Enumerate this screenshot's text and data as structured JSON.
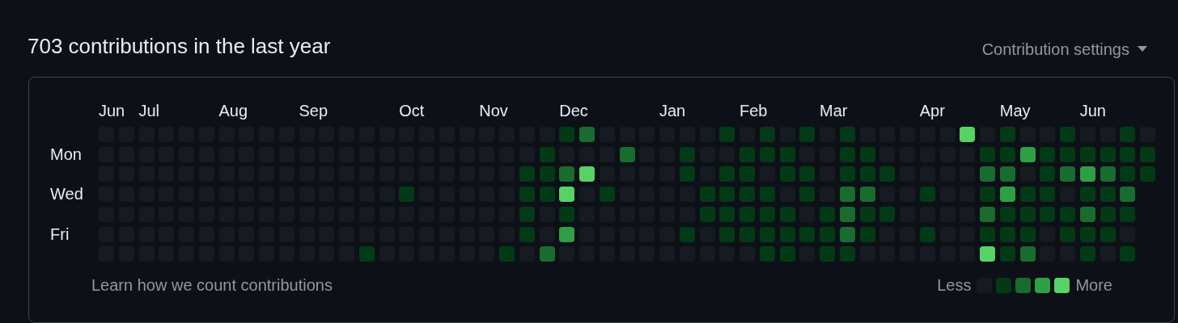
{
  "title": "703 contributions in the last year",
  "settings": {
    "label": "Contribution settings"
  },
  "day_labels": [
    "Mon",
    "Wed",
    "Fri"
  ],
  "weeks": [
    {
      "month": "Jun",
      "days": [
        {
          "color": "#161b22"
        },
        {
          "color": "#161b22"
        },
        {
          "color": "#161b22"
        },
        {
          "color": "#161b22"
        },
        {
          "color": "#161b22"
        },
        {
          "color": "#161b22"
        },
        {
          "color": "#161b22"
        }
      ]
    },
    {
      "days": [
        {
          "color": "#161b22"
        },
        {
          "color": "#161b22"
        },
        {
          "color": "#161b22"
        },
        {
          "color": "#161b22"
        },
        {
          "color": "#161b22"
        },
        {
          "color": "#161b22"
        },
        {
          "color": "#161b22"
        }
      ]
    },
    {
      "month": "Jul",
      "days": [
        {
          "color": "#161b22"
        },
        {
          "color": "#161b22"
        },
        {
          "color": "#161b22"
        },
        {
          "color": "#161b22"
        },
        {
          "color": "#161b22"
        },
        {
          "color": "#161b22"
        },
        {
          "color": "#161b22"
        }
      ]
    },
    {
      "days": [
        {
          "color": "#161b22"
        },
        {
          "color": "#161b22"
        },
        {
          "color": "#161b22"
        },
        {
          "color": "#161b22"
        },
        {
          "color": "#161b22"
        },
        {
          "color": "#161b22"
        },
        {
          "color": "#161b22"
        }
      ]
    },
    {
      "days": [
        {
          "color": "#161b22"
        },
        {
          "color": "#161b22"
        },
        {
          "color": "#161b22"
        },
        {
          "color": "#161b22"
        },
        {
          "color": "#161b22"
        },
        {
          "color": "#161b22"
        },
        {
          "color": "#161b22"
        }
      ]
    },
    {
      "days": [
        {
          "color": "#161b22"
        },
        {
          "color": "#161b22"
        },
        {
          "color": "#161b22"
        },
        {
          "color": "#161b22"
        },
        {
          "color": "#161b22"
        },
        {
          "color": "#161b22"
        },
        {
          "color": "#161b22"
        }
      ]
    },
    {
      "month": "Aug",
      "days": [
        {
          "color": "#161b22"
        },
        {
          "color": "#161b22"
        },
        {
          "color": "#161b22"
        },
        {
          "color": "#161b22"
        },
        {
          "color": "#161b22"
        },
        {
          "color": "#161b22"
        },
        {
          "color": "#161b22"
        }
      ]
    },
    {
      "days": [
        {
          "color": "#161b22"
        },
        {
          "color": "#161b22"
        },
        {
          "color": "#161b22"
        },
        {
          "color": "#161b22"
        },
        {
          "color": "#161b22"
        },
        {
          "color": "#161b22"
        },
        {
          "color": "#161b22"
        }
      ]
    },
    {
      "days": [
        {
          "color": "#161b22"
        },
        {
          "color": "#161b22"
        },
        {
          "color": "#161b22"
        },
        {
          "color": "#161b22"
        },
        {
          "color": "#161b22"
        },
        {
          "color": "#161b22"
        },
        {
          "color": "#161b22"
        }
      ]
    },
    {
      "days": [
        {
          "color": "#161b22"
        },
        {
          "color": "#161b22"
        },
        {
          "color": "#161b22"
        },
        {
          "color": "#161b22"
        },
        {
          "color": "#161b22"
        },
        {
          "color": "#161b22"
        },
        {
          "color": "#161b22"
        }
      ]
    },
    {
      "month": "Sep",
      "days": [
        {
          "color": "#161b22"
        },
        {
          "color": "#161b22"
        },
        {
          "color": "#161b22"
        },
        {
          "color": "#161b22"
        },
        {
          "color": "#161b22"
        },
        {
          "color": "#161b22"
        },
        {
          "color": "#161b22"
        }
      ]
    },
    {
      "days": [
        {
          "color": "#161b22"
        },
        {
          "color": "#161b22"
        },
        {
          "color": "#161b22"
        },
        {
          "color": "#161b22"
        },
        {
          "color": "#161b22"
        },
        {
          "color": "#161b22"
        },
        {
          "color": "#161b22"
        }
      ]
    },
    {
      "days": [
        {
          "color": "#161b22"
        },
        {
          "color": "#161b22"
        },
        {
          "color": "#161b22"
        },
        {
          "color": "#161b22"
        },
        {
          "color": "#161b22"
        },
        {
          "color": "#161b22"
        },
        {
          "color": "#161b22"
        }
      ]
    },
    {
      "days": [
        {
          "color": "#161b22"
        },
        {
          "color": "#161b22"
        },
        {
          "color": "#161b22"
        },
        {
          "color": "#161b22"
        },
        {
          "color": "#161b22"
        },
        {
          "color": "#161b22"
        },
        {
          "color": "#033a16"
        }
      ]
    },
    {
      "days": [
        {
          "color": "#161b22"
        },
        {
          "color": "#161b22"
        },
        {
          "color": "#161b22"
        },
        {
          "color": "#161b22"
        },
        {
          "color": "#161b22"
        },
        {
          "color": "#161b22"
        },
        {
          "color": "#161b22"
        }
      ]
    },
    {
      "month": "Oct",
      "days": [
        {
          "color": "#161b22"
        },
        {
          "color": "#161b22"
        },
        {
          "color": "#161b22"
        },
        {
          "color": "#033a16"
        },
        {
          "color": "#161b22"
        },
        {
          "color": "#161b22"
        },
        {
          "color": "#161b22"
        }
      ]
    },
    {
      "days": [
        {
          "color": "#161b22"
        },
        {
          "color": "#161b22"
        },
        {
          "color": "#161b22"
        },
        {
          "color": "#161b22"
        },
        {
          "color": "#161b22"
        },
        {
          "color": "#161b22"
        },
        {
          "color": "#161b22"
        }
      ]
    },
    {
      "days": [
        {
          "color": "#161b22"
        },
        {
          "color": "#161b22"
        },
        {
          "color": "#161b22"
        },
        {
          "color": "#161b22"
        },
        {
          "color": "#161b22"
        },
        {
          "color": "#161b22"
        },
        {
          "color": "#161b22"
        }
      ]
    },
    {
      "days": [
        {
          "color": "#161b22"
        },
        {
          "color": "#161b22"
        },
        {
          "color": "#161b22"
        },
        {
          "color": "#161b22"
        },
        {
          "color": "#161b22"
        },
        {
          "color": "#161b22"
        },
        {
          "color": "#161b22"
        }
      ]
    },
    {
      "month": "Nov",
      "days": [
        {
          "color": "#161b22"
        },
        {
          "color": "#161b22"
        },
        {
          "color": "#161b22"
        },
        {
          "color": "#161b22"
        },
        {
          "color": "#161b22"
        },
        {
          "color": "#161b22"
        },
        {
          "color": "#161b22"
        }
      ]
    },
    {
      "days": [
        {
          "color": "#161b22"
        },
        {
          "color": "#161b22"
        },
        {
          "color": "#161b22"
        },
        {
          "color": "#161b22"
        },
        {
          "color": "#161b22"
        },
        {
          "color": "#161b22"
        },
        {
          "color": "#033a16"
        }
      ]
    },
    {
      "days": [
        {
          "color": "#161b22"
        },
        {
          "color": "#161b22"
        },
        {
          "color": "#033a16"
        },
        {
          "color": "#033a16"
        },
        {
          "color": "#033a16"
        },
        {
          "color": "#033a16"
        },
        {
          "color": "#161b22"
        }
      ]
    },
    {
      "days": [
        {
          "color": "#161b22"
        },
        {
          "color": "#033a16"
        },
        {
          "color": "#033a16"
        },
        {
          "color": "#033a16"
        },
        {
          "color": "#161b22"
        },
        {
          "color": "#161b22"
        },
        {
          "color": "#196c2e"
        }
      ]
    },
    {
      "month": "Dec",
      "days": [
        {
          "color": "#033a16"
        },
        {
          "color": "#161b22"
        },
        {
          "color": "#196c2e"
        },
        {
          "color": "#56d364"
        },
        {
          "color": "#033a16"
        },
        {
          "color": "#2ea043"
        },
        {
          "color": "#161b22"
        }
      ]
    },
    {
      "days": [
        {
          "color": "#196c2e"
        },
        {
          "color": "#161b22"
        },
        {
          "color": "#56d364"
        },
        {
          "color": "#161b22"
        },
        {
          "color": "#161b22"
        },
        {
          "color": "#161b22"
        },
        {
          "color": "#161b22"
        }
      ]
    },
    {
      "days": [
        {
          "color": "#161b22"
        },
        {
          "color": "#161b22"
        },
        {
          "color": "#161b22"
        },
        {
          "color": "#033a16"
        },
        {
          "color": "#161b22"
        },
        {
          "color": "#161b22"
        },
        {
          "color": "#161b22"
        }
      ]
    },
    {
      "days": [
        {
          "color": "#161b22"
        },
        {
          "color": "#196c2e"
        },
        {
          "color": "#161b22"
        },
        {
          "color": "#161b22"
        },
        {
          "color": "#161b22"
        },
        {
          "color": "#161b22"
        },
        {
          "color": "#161b22"
        }
      ]
    },
    {
      "days": [
        {
          "color": "#161b22"
        },
        {
          "color": "#161b22"
        },
        {
          "color": "#161b22"
        },
        {
          "color": "#161b22"
        },
        {
          "color": "#161b22"
        },
        {
          "color": "#161b22"
        },
        {
          "color": "#161b22"
        }
      ]
    },
    {
      "month": "Jan",
      "days": [
        {
          "color": "#161b22"
        },
        {
          "color": "#161b22"
        },
        {
          "color": "#161b22"
        },
        {
          "color": "#161b22"
        },
        {
          "color": "#161b22"
        },
        {
          "color": "#161b22"
        },
        {
          "color": "#161b22"
        }
      ]
    },
    {
      "days": [
        {
          "color": "#161b22"
        },
        {
          "color": "#033a16"
        },
        {
          "color": "#033a16"
        },
        {
          "color": "#161b22"
        },
        {
          "color": "#161b22"
        },
        {
          "color": "#033a16"
        },
        {
          "color": "#161b22"
        }
      ]
    },
    {
      "days": [
        {
          "color": "#161b22"
        },
        {
          "color": "#161b22"
        },
        {
          "color": "#161b22"
        },
        {
          "color": "#033a16"
        },
        {
          "color": "#033a16"
        },
        {
          "color": "#161b22"
        },
        {
          "color": "#161b22"
        }
      ]
    },
    {
      "days": [
        {
          "color": "#033a16"
        },
        {
          "color": "#161b22"
        },
        {
          "color": "#033a16"
        },
        {
          "color": "#033a16"
        },
        {
          "color": "#033a16"
        },
        {
          "color": "#033a16"
        },
        {
          "color": "#161b22"
        }
      ]
    },
    {
      "month": "Feb",
      "days": [
        {
          "color": "#161b22"
        },
        {
          "color": "#033a16"
        },
        {
          "color": "#033a16"
        },
        {
          "color": "#033a16"
        },
        {
          "color": "#033a16"
        },
        {
          "color": "#033a16"
        },
        {
          "color": "#161b22"
        }
      ]
    },
    {
      "days": [
        {
          "color": "#033a16"
        },
        {
          "color": "#033a16"
        },
        {
          "color": "#161b22"
        },
        {
          "color": "#033a16"
        },
        {
          "color": "#033a16"
        },
        {
          "color": "#033a16"
        },
        {
          "color": "#033a16"
        }
      ]
    },
    {
      "days": [
        {
          "color": "#161b22"
        },
        {
          "color": "#033a16"
        },
        {
          "color": "#033a16"
        },
        {
          "color": "#161b22"
        },
        {
          "color": "#033a16"
        },
        {
          "color": "#033a16"
        },
        {
          "color": "#033a16"
        }
      ]
    },
    {
      "days": [
        {
          "color": "#033a16"
        },
        {
          "color": "#161b22"
        },
        {
          "color": "#033a16"
        },
        {
          "color": "#033a16"
        },
        {
          "color": "#161b22"
        },
        {
          "color": "#033a16"
        },
        {
          "color": "#161b22"
        }
      ]
    },
    {
      "month": "Mar",
      "days": [
        {
          "color": "#161b22"
        },
        {
          "color": "#161b22"
        },
        {
          "color": "#161b22"
        },
        {
          "color": "#161b22"
        },
        {
          "color": "#033a16"
        },
        {
          "color": "#033a16"
        },
        {
          "color": "#033a16"
        }
      ]
    },
    {
      "days": [
        {
          "color": "#033a16"
        },
        {
          "color": "#033a16"
        },
        {
          "color": "#033a16"
        },
        {
          "color": "#196c2e"
        },
        {
          "color": "#196c2e"
        },
        {
          "color": "#196c2e"
        },
        {
          "color": "#033a16"
        }
      ]
    },
    {
      "days": [
        {
          "color": "#161b22"
        },
        {
          "color": "#033a16"
        },
        {
          "color": "#033a16"
        },
        {
          "color": "#196c2e"
        },
        {
          "color": "#033a16"
        },
        {
          "color": "#033a16"
        },
        {
          "color": "#161b22"
        }
      ]
    },
    {
      "days": [
        {
          "color": "#161b22"
        },
        {
          "color": "#161b22"
        },
        {
          "color": "#033a16"
        },
        {
          "color": "#161b22"
        },
        {
          "color": "#033a16"
        },
        {
          "color": "#161b22"
        },
        {
          "color": "#161b22"
        }
      ]
    },
    {
      "days": [
        {
          "color": "#161b22"
        },
        {
          "color": "#161b22"
        },
        {
          "color": "#161b22"
        },
        {
          "color": "#161b22"
        },
        {
          "color": "#161b22"
        },
        {
          "color": "#161b22"
        },
        {
          "color": "#161b22"
        }
      ]
    },
    {
      "month": "Apr",
      "days": [
        {
          "color": "#161b22"
        },
        {
          "color": "#161b22"
        },
        {
          "color": "#161b22"
        },
        {
          "color": "#033a16"
        },
        {
          "color": "#161b22"
        },
        {
          "color": "#033a16"
        },
        {
          "color": "#161b22"
        }
      ]
    },
    {
      "days": [
        {
          "color": "#161b22"
        },
        {
          "color": "#161b22"
        },
        {
          "color": "#161b22"
        },
        {
          "color": "#161b22"
        },
        {
          "color": "#161b22"
        },
        {
          "color": "#161b22"
        },
        {
          "color": "#161b22"
        }
      ]
    },
    {
      "days": [
        {
          "color": "#56d364"
        },
        {
          "color": "#161b22"
        },
        {
          "color": "#161b22"
        },
        {
          "color": "#161b22"
        },
        {
          "color": "#161b22"
        },
        {
          "color": "#161b22"
        },
        {
          "color": "#161b22"
        }
      ]
    },
    {
      "days": [
        {
          "color": "#161b22"
        },
        {
          "color": "#033a16"
        },
        {
          "color": "#196c2e"
        },
        {
          "color": "#033a16"
        },
        {
          "color": "#196c2e"
        },
        {
          "color": "#033a16"
        },
        {
          "color": "#56d364"
        }
      ]
    },
    {
      "month": "May",
      "days": [
        {
          "color": "#033a16"
        },
        {
          "color": "#033a16"
        },
        {
          "color": "#196c2e"
        },
        {
          "color": "#2ea043"
        },
        {
          "color": "#033a16"
        },
        {
          "color": "#033a16"
        },
        {
          "color": "#033a16"
        }
      ]
    },
    {
      "days": [
        {
          "color": "#161b22"
        },
        {
          "color": "#2ea043"
        },
        {
          "color": "#161b22"
        },
        {
          "color": "#033a16"
        },
        {
          "color": "#033a16"
        },
        {
          "color": "#033a16"
        },
        {
          "color": "#196c2e"
        }
      ]
    },
    {
      "days": [
        {
          "color": "#161b22"
        },
        {
          "color": "#033a16"
        },
        {
          "color": "#033a16"
        },
        {
          "color": "#033a16"
        },
        {
          "color": "#033a16"
        },
        {
          "color": "#161b22"
        },
        {
          "color": "#161b22"
        }
      ]
    },
    {
      "days": [
        {
          "color": "#033a16"
        },
        {
          "color": "#033a16"
        },
        {
          "color": "#196c2e"
        },
        {
          "color": "#161b22"
        },
        {
          "color": "#033a16"
        },
        {
          "color": "#033a16"
        },
        {
          "color": "#161b22"
        }
      ]
    },
    {
      "month": "Jun",
      "days": [
        {
          "color": "#161b22"
        },
        {
          "color": "#033a16"
        },
        {
          "color": "#2ea043"
        },
        {
          "color": "#033a16"
        },
        {
          "color": "#196c2e"
        },
        {
          "color": "#033a16"
        },
        {
          "color": "#033a16"
        }
      ]
    },
    {
      "days": [
        {
          "color": "#161b22"
        },
        {
          "color": "#033a16"
        },
        {
          "color": "#196c2e"
        },
        {
          "color": "#033a16"
        },
        {
          "color": "#033a16"
        },
        {
          "color": "#033a16"
        },
        {
          "color": "#161b22"
        }
      ]
    },
    {
      "days": [
        {
          "color": "#033a16"
        },
        {
          "color": "#033a16"
        },
        {
          "color": "#033a16"
        },
        {
          "color": "#196c2e"
        },
        {
          "color": "#033a16"
        },
        {
          "color": "#161b22"
        },
        {
          "color": "#033a16"
        }
      ]
    },
    {
      "days": [
        {
          "color": "#161b22"
        },
        {
          "color": "#033a16"
        },
        {
          "color": "#033a16"
        }
      ]
    }
  ],
  "footer": {
    "link": "Learn how we count contributions"
  },
  "legend": {
    "less": "Less",
    "more": "More",
    "levels": [
      {
        "color": "#161b22"
      },
      {
        "color": "#033a16"
      },
      {
        "color": "#196c2e"
      },
      {
        "color": "#2ea043"
      },
      {
        "color": "#56d364"
      }
    ]
  }
}
